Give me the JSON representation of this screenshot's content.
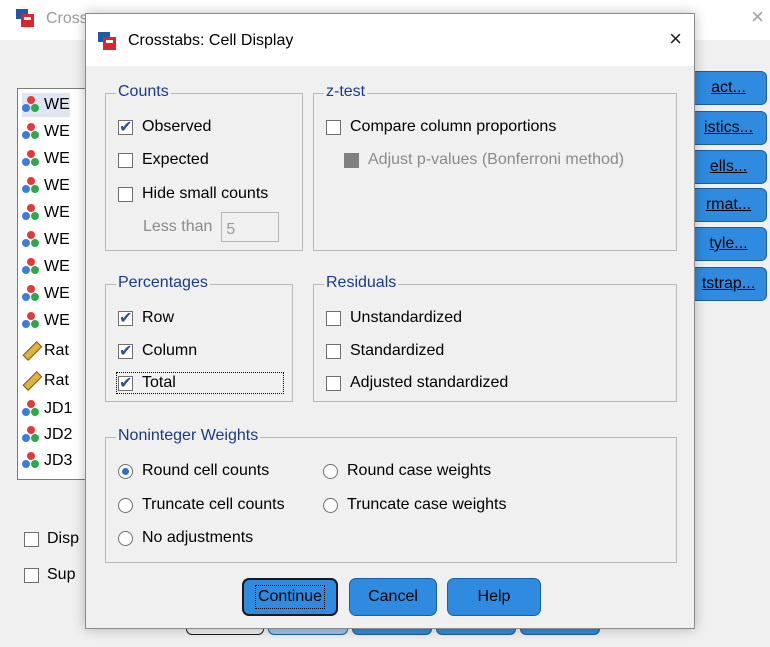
{
  "parent": {
    "title_fragment": "Cross",
    "close_glyph": "×",
    "variables": [
      "WE",
      "WE",
      "WE",
      "WE",
      "WE",
      "WE",
      "WE",
      "WE",
      "WE",
      "Rat",
      "Rat",
      "JD1",
      "JD2",
      "JD3"
    ],
    "side_buttons": [
      "act...",
      "istics...",
      "ells...",
      "rmat...",
      "tyle...",
      "tstrap..."
    ],
    "checkbox_rows": [
      "Disp",
      "Sup"
    ]
  },
  "dialog": {
    "title": "Crosstabs: Cell Display",
    "close_glyph": "×",
    "counts": {
      "label": "Counts",
      "observed": "Observed",
      "expected": "Expected",
      "hide_small": "Hide small counts",
      "less_than_label": "Less than",
      "less_than_value": "5"
    },
    "ztest": {
      "label": "z-test",
      "compare": "Compare column proportions",
      "adjust": "Adjust p-values (Bonferroni method)"
    },
    "percentages": {
      "label": "Percentages",
      "row": "Row",
      "column": "Column",
      "total": "Total"
    },
    "residuals": {
      "label": "Residuals",
      "unstandardized": "Unstandardized",
      "standardized": "Standardized",
      "adjusted": "Adjusted standardized"
    },
    "weights": {
      "label": "Noninteger Weights",
      "round_cell": "Round cell counts",
      "round_case": "Round case weights",
      "truncate_cell": "Truncate cell counts",
      "truncate_case": "Truncate case weights",
      "no_adjust": "No adjustments"
    },
    "buttons": {
      "continue": "Continue",
      "cancel": "Cancel",
      "help": "Help"
    }
  },
  "state": {
    "observed": true,
    "expected": false,
    "hide_small": false,
    "compare": false,
    "adjust": false,
    "row": true,
    "column": true,
    "total": true,
    "unstandardized": false,
    "standardized": false,
    "adjusted": false,
    "weight_selected": "Round cell counts"
  },
  "colors": {
    "accent_button": "#2f8be0",
    "group_label": "#1a3a8c"
  }
}
